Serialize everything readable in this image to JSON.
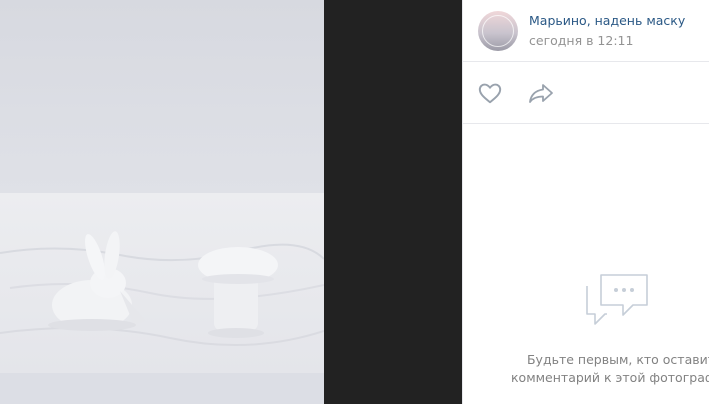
{
  "post": {
    "author": "Марьино, надень маску",
    "time": "сегодня в 12:11"
  },
  "actions": {
    "like_icon": "heart-outline-icon",
    "share_icon": "share-arrow-icon"
  },
  "comments": {
    "empty_icon": "chat-bubbles-icon",
    "empty_line1": "Будьте первым, кто оставит",
    "empty_line2": "комментарий к этой фотографии"
  },
  "colors": {
    "link": "#2a5885",
    "muted": "#939393",
    "icon": "#99a2ad",
    "viewer_bg": "#222222"
  }
}
